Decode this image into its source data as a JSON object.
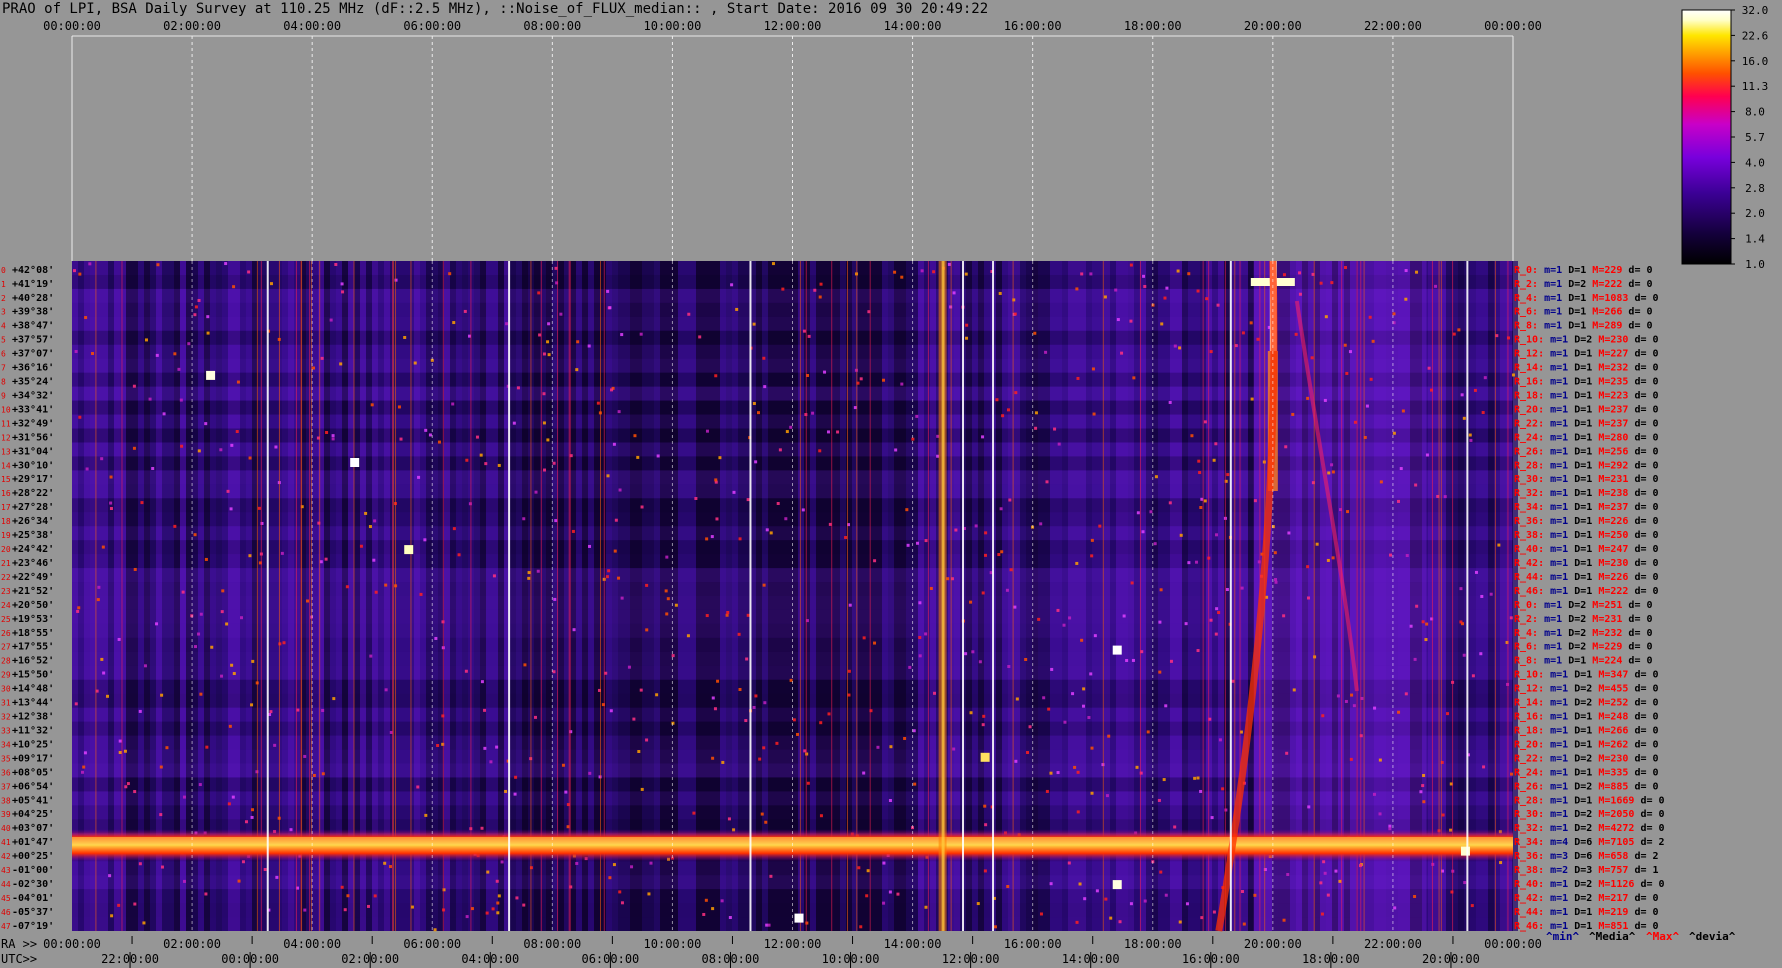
{
  "title": "PRAO of LPI, BSA Daily Survey at 110.25 MHz (dF::2.5 MHz), ::Noise_of_FLUX_median:: , Start Date: 2016 09 30 20:49:22",
  "chart_data": {
    "type": "heatmap",
    "top_axis_ticks": [
      "00:00:00",
      "02:00:00",
      "04:00:00",
      "06:00:00",
      "08:00:00",
      "10:00:00",
      "12:00:00",
      "14:00:00",
      "16:00:00",
      "18:00:00",
      "20:00:00",
      "22:00:00",
      "00:00:00"
    ],
    "ra_label": "RA >>",
    "ra_ticks": [
      "00:00:00",
      "02:00:00",
      "04:00:00",
      "06:00:00",
      "08:00:00",
      "10:00:00",
      "12:00:00",
      "14:00:00",
      "16:00:00",
      "18:00:00",
      "20:00:00",
      "22:00:00",
      "00:00:00"
    ],
    "utc_label": "UTC>>",
    "utc_ticks": [
      "22:00:00",
      "00:00:00",
      "02:00:00",
      "04:00:00",
      "06:00:00",
      "08:00:00",
      "10:00:00",
      "12:00:00",
      "14:00:00",
      "16:00:00",
      "18:00:00",
      "20:00:00"
    ],
    "declinations": [
      "+42°08'",
      "+41°19'",
      "+40°28'",
      "+39°38'",
      "+38°47'",
      "+37°57'",
      "+37°07'",
      "+36°16'",
      "+35°24'",
      "+34°32'",
      "+33°41'",
      "+32°49'",
      "+31°56'",
      "+31°04'",
      "+30°10'",
      "+29°17'",
      "+28°22'",
      "+27°28'",
      "+26°34'",
      "+25°38'",
      "+24°42'",
      "+23°46'",
      "+22°49'",
      "+21°52'",
      "+20°50'",
      "+19°53'",
      "+18°55'",
      "+17°55'",
      "+16°52'",
      "+15°50'",
      "+14°48'",
      "+13°44'",
      "+12°38'",
      "+11°32'",
      "+10°25'",
      "+09°17'",
      "+08°05'",
      "+06°54'",
      "+05°41'",
      "+04°25'",
      "+03°07'",
      "+01°47'",
      "+00°25'",
      "-01°00'",
      "-02°30'",
      "-04°01'",
      "-05°37'",
      "-07°19'"
    ],
    "row_stats": [
      {
        "r": "R_0:",
        "m": "m=1",
        "d": "D=1",
        "M": "M=229",
        "dv": "d= 0"
      },
      {
        "r": "R_2:",
        "m": "m=1",
        "d": "D=2",
        "M": "M=222",
        "dv": "d= 0"
      },
      {
        "r": "R_4:",
        "m": "m=1",
        "d": "D=1",
        "M": "M=1083",
        "dv": "d= 0"
      },
      {
        "r": "R_6:",
        "m": "m=1",
        "d": "D=1",
        "M": "M=266",
        "dv": "d= 0"
      },
      {
        "r": "R_8:",
        "m": "m=1",
        "d": "D=1",
        "M": "M=289",
        "dv": "d= 0"
      },
      {
        "r": "R_10:",
        "m": "m=1",
        "d": "D=2",
        "M": "M=230",
        "dv": "d= 0"
      },
      {
        "r": "R_12:",
        "m": "m=1",
        "d": "D=1",
        "M": "M=227",
        "dv": "d= 0"
      },
      {
        "r": "R_14:",
        "m": "m=1",
        "d": "D=1",
        "M": "M=232",
        "dv": "d= 0"
      },
      {
        "r": "R_16:",
        "m": "m=1",
        "d": "D=1",
        "M": "M=235",
        "dv": "d= 0"
      },
      {
        "r": "R_18:",
        "m": "m=1",
        "d": "D=1",
        "M": "M=223",
        "dv": "d= 0"
      },
      {
        "r": "R_20:",
        "m": "m=1",
        "d": "D=1",
        "M": "M=237",
        "dv": "d= 0"
      },
      {
        "r": "R_22:",
        "m": "m=1",
        "d": "D=1",
        "M": "M=237",
        "dv": "d= 0"
      },
      {
        "r": "R_24:",
        "m": "m=1",
        "d": "D=1",
        "M": "M=280",
        "dv": "d= 0"
      },
      {
        "r": "R_26:",
        "m": "m=1",
        "d": "D=1",
        "M": "M=256",
        "dv": "d= 0"
      },
      {
        "r": "R_28:",
        "m": "m=1",
        "d": "D=1",
        "M": "M=292",
        "dv": "d= 0"
      },
      {
        "r": "R_30:",
        "m": "m=1",
        "d": "D=1",
        "M": "M=231",
        "dv": "d= 0"
      },
      {
        "r": "R_32:",
        "m": "m=1",
        "d": "D=1",
        "M": "M=238",
        "dv": "d= 0"
      },
      {
        "r": "R_34:",
        "m": "m=1",
        "d": "D=1",
        "M": "M=237",
        "dv": "d= 0"
      },
      {
        "r": "R_36:",
        "m": "m=1",
        "d": "D=1",
        "M": "M=226",
        "dv": "d= 0"
      },
      {
        "r": "R_38:",
        "m": "m=1",
        "d": "D=1",
        "M": "M=250",
        "dv": "d= 0"
      },
      {
        "r": "R_40:",
        "m": "m=1",
        "d": "D=1",
        "M": "M=247",
        "dv": "d= 0"
      },
      {
        "r": "R_42:",
        "m": "m=1",
        "d": "D=1",
        "M": "M=230",
        "dv": "d= 0"
      },
      {
        "r": "R_44:",
        "m": "m=1",
        "d": "D=1",
        "M": "M=226",
        "dv": "d= 0"
      },
      {
        "r": "R_46:",
        "m": "m=1",
        "d": "D=1",
        "M": "M=222",
        "dv": "d= 0"
      },
      {
        "r": "R_0:",
        "m": "m=1",
        "d": "D=2",
        "M": "M=251",
        "dv": "d= 0"
      },
      {
        "r": "R_2:",
        "m": "m=1",
        "d": "D=2",
        "M": "M=231",
        "dv": "d= 0"
      },
      {
        "r": "R_4:",
        "m": "m=1",
        "d": "D=2",
        "M": "M=232",
        "dv": "d= 0"
      },
      {
        "r": "R_6:",
        "m": "m=1",
        "d": "D=2",
        "M": "M=229",
        "dv": "d= 0"
      },
      {
        "r": "R_8:",
        "m": "m=1",
        "d": "D=1",
        "M": "M=224",
        "dv": "d= 0"
      },
      {
        "r": "R_10:",
        "m": "m=1",
        "d": "D=1",
        "M": "M=347",
        "dv": "d= 0"
      },
      {
        "r": "R_12:",
        "m": "m=1",
        "d": "D=2",
        "M": "M=455",
        "dv": "d= 0"
      },
      {
        "r": "R_14:",
        "m": "m=1",
        "d": "D=2",
        "M": "M=252",
        "dv": "d= 0"
      },
      {
        "r": "R_16:",
        "m": "m=1",
        "d": "D=1",
        "M": "M=248",
        "dv": "d= 0"
      },
      {
        "r": "R_18:",
        "m": "m=1",
        "d": "D=1",
        "M": "M=266",
        "dv": "d= 0"
      },
      {
        "r": "R_20:",
        "m": "m=1",
        "d": "D=1",
        "M": "M=262",
        "dv": "d= 0"
      },
      {
        "r": "R_22:",
        "m": "m=1",
        "d": "D=2",
        "M": "M=230",
        "dv": "d= 0"
      },
      {
        "r": "R_24:",
        "m": "m=1",
        "d": "D=1",
        "M": "M=335",
        "dv": "d= 0"
      },
      {
        "r": "R_26:",
        "m": "m=1",
        "d": "D=2",
        "M": "M=885",
        "dv": "d= 0"
      },
      {
        "r": "R_28:",
        "m": "m=1",
        "d": "D=1",
        "M": "M=1669",
        "dv": "d= 0"
      },
      {
        "r": "R_30:",
        "m": "m=1",
        "d": "D=2",
        "M": "M=2050",
        "dv": "d= 0"
      },
      {
        "r": "R_32:",
        "m": "m=1",
        "d": "D=2",
        "M": "M=4272",
        "dv": "d= 0"
      },
      {
        "r": "R_34:",
        "m": "m=4",
        "d": "D=6",
        "M": "M=7105",
        "dv": "d= 2"
      },
      {
        "r": "R_36:",
        "m": "m=3",
        "d": "D=6",
        "M": "M=658",
        "dv": "d= 2"
      },
      {
        "r": "R_38:",
        "m": "m=2",
        "d": "D=3",
        "M": "M=757",
        "dv": "d= 1"
      },
      {
        "r": "R_40:",
        "m": "m=1",
        "d": "D=2",
        "M": "M=1126",
        "dv": "d= 0"
      },
      {
        "r": "R_42:",
        "m": "m=1",
        "d": "D=2",
        "M": "M=217",
        "dv": "d= 0"
      },
      {
        "r": "R_44:",
        "m": "m=1",
        "d": "D=1",
        "M": "M=219",
        "dv": "d= 0"
      },
      {
        "r": "R_46:",
        "m": "m=1",
        "d": "D=1",
        "M": "M=851",
        "dv": "d= 0"
      }
    ],
    "stats_legend": [
      {
        "text": "^min^",
        "color": "#00008b"
      },
      {
        "text": "^Media^",
        "color": "#000000"
      },
      {
        "text": "^Max^",
        "color": "#ff0000"
      },
      {
        "text": "^devia^",
        "color": "#000000"
      }
    ],
    "colorbar": {
      "ticks": [
        "32.0",
        "22.6",
        "16.0",
        "11.3",
        "8.0",
        "5.7",
        "4.0",
        "2.8",
        "2.0",
        "1.4",
        "1.0"
      ],
      "colors": [
        "#000000",
        "#14003c",
        "#3c0096",
        "#7800dc",
        "#c800c8",
        "#ff0050",
        "#ff5000",
        "#ffa000",
        "#ffe600",
        "#ffffc8",
        "#ffffff"
      ]
    }
  }
}
